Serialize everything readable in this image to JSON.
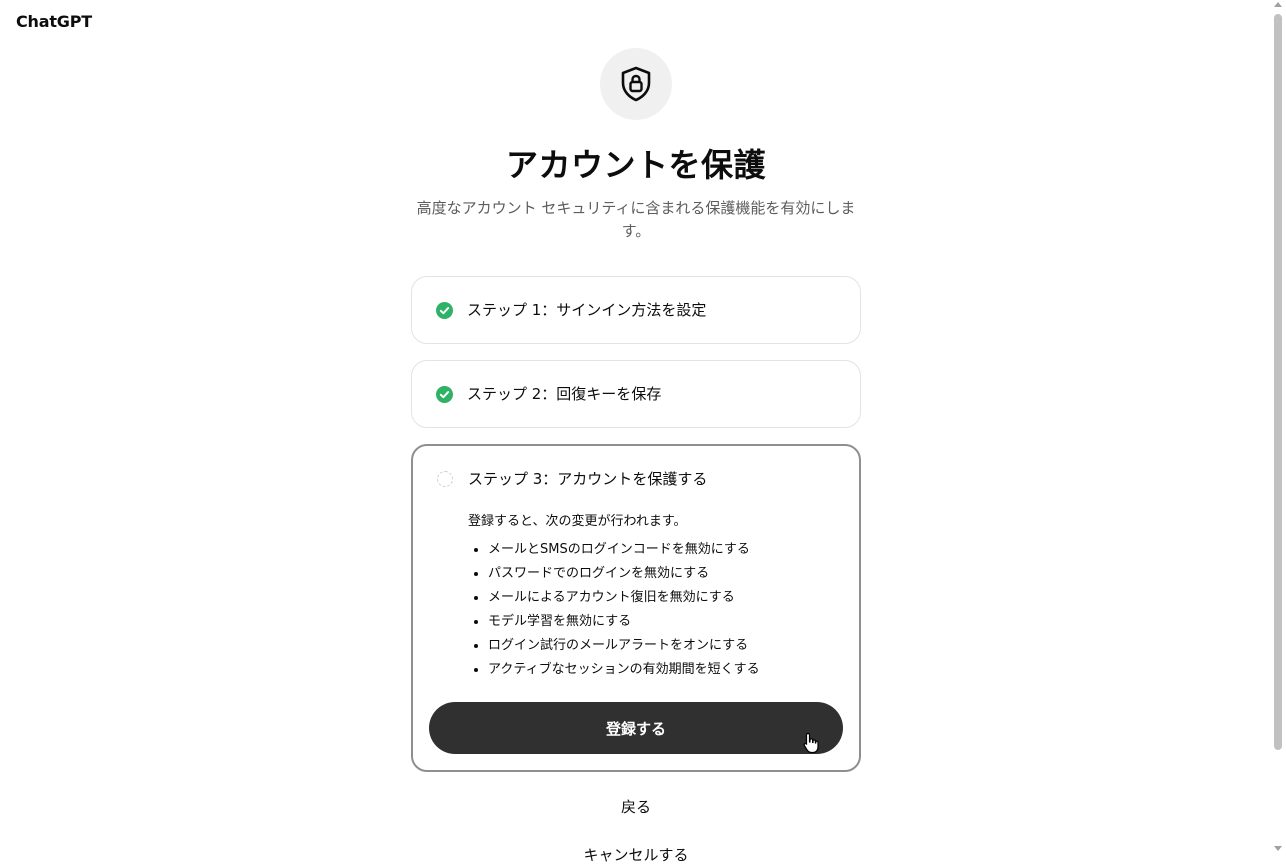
{
  "brand": "ChatGPT",
  "page": {
    "title": "アカウントを保護",
    "subtitle": "高度なアカウント セキュリティに含まれる保護機能を有効にします。"
  },
  "steps": [
    {
      "label": "ステップ 1：サインイン方法を設定",
      "status": "complete"
    },
    {
      "label": "ステップ 2：回復キーを保存",
      "status": "complete"
    },
    {
      "label": "ステップ 3：アカウントを保護する",
      "status": "pending",
      "intro": "登録すると、次の変更が行われます。",
      "changes": [
        "メールとSMSのログインコードを無効にする",
        "パスワードでのログインを無効にする",
        "メールによるアカウント復旧を無効にする",
        "モデル学習を無効にする",
        "ログイン試行のメールアラートをオンにする",
        "アクティブなセッションの有効期間を短くする"
      ],
      "button": "登録する"
    }
  ],
  "links": {
    "back": "戻る",
    "cancel": "キャンセルする"
  },
  "icons": {
    "hero": "shield-lock-icon",
    "complete": "check-circle-icon",
    "pending": "dashed-circle-icon"
  },
  "colors": {
    "check_green": "#2fb266",
    "button_dark": "#303030",
    "active_border": "#8f8f8f"
  }
}
